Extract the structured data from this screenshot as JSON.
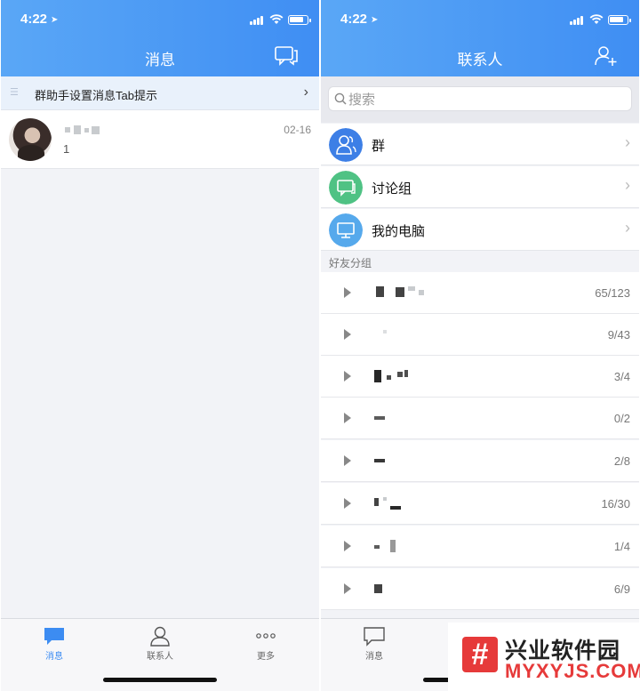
{
  "status_bar": {
    "time": "4:22",
    "location_glyph": "➤"
  },
  "left": {
    "title": "消息",
    "banner": {
      "text": "群助手设置消息Tab提示",
      "chevron": "›"
    },
    "conversation": {
      "message": "1",
      "time": "02-16"
    },
    "tabs": [
      {
        "label": "消息",
        "icon": "message-icon",
        "active": true
      },
      {
        "label": "联系人",
        "icon": "person-icon",
        "active": false
      },
      {
        "label": "更多",
        "icon": "more-icon",
        "active": false
      }
    ]
  },
  "right": {
    "title": "联系人",
    "search": {
      "placeholder": "搜索"
    },
    "entries": [
      {
        "label": "群",
        "icon": "group-icon",
        "color": "#3d7fe6"
      },
      {
        "label": "讨论组",
        "icon": "chat-icon",
        "color": "#4fc284"
      },
      {
        "label": "我的电脑",
        "icon": "computer-icon",
        "color": "#56a9ec"
      }
    ],
    "section_header": "好友分组",
    "groups": [
      {
        "count": "65/123"
      },
      {
        "count": "9/43"
      },
      {
        "count": "3/4"
      },
      {
        "count": "0/2"
      },
      {
        "count": "2/8"
      },
      {
        "count": "16/30"
      },
      {
        "count": "1/4"
      },
      {
        "count": "6/9"
      }
    ],
    "tab_first_label": "消息"
  },
  "watermark": {
    "cn": "兴业软件园",
    "en": "MYXYJS.COM",
    "logo": "#"
  },
  "colors": {
    "accent": "#3c8cf2",
    "header_start": "#5aa7f6",
    "header_end": "#3f8ef3"
  }
}
